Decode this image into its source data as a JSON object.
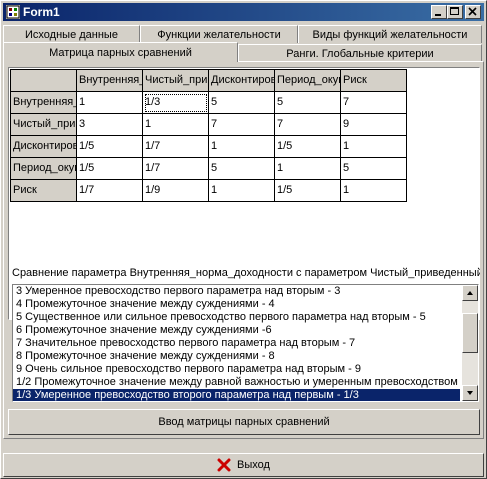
{
  "window": {
    "title": "Form1"
  },
  "tabs": {
    "row1": [
      "Исходные данные",
      "Функции желательности",
      "Виды функций желательности"
    ],
    "row2": [
      "Матрица парных сравнений",
      "Ранги. Глобальные критерии"
    ]
  },
  "grid": {
    "columns": [
      "Внутренняя_норма_доходности",
      "Чистый_приведенный",
      "Дисконтированный",
      "Период_окупаемости",
      "Риск"
    ],
    "rows": [
      {
        "name": "Внутренняя_норма_доходности",
        "values": [
          "1",
          "1/3",
          "5",
          "5",
          "7"
        ]
      },
      {
        "name": "Чистый_приведенный",
        "values": [
          "3",
          "1",
          "7",
          "7",
          "9"
        ]
      },
      {
        "name": "Дисконтированный",
        "values": [
          "1/5",
          "1/7",
          "1",
          "1/5",
          "1"
        ]
      },
      {
        "name": "Период_окупаемости",
        "values": [
          "1/5",
          "1/7",
          "5",
          "1",
          "5"
        ]
      },
      {
        "name": "Риск",
        "values": [
          "1/7",
          "1/9",
          "1",
          "1/5",
          "1"
        ]
      }
    ]
  },
  "comparison_label": "Сравнение параметра Внутренняя_норма_доходности с параметром Чистый_приведенный",
  "list": {
    "items": [
      "3 Умеренное превосходство первого параметра  над вторым - 3",
      "4 Промежуточное значение между суждениями - 4",
      "5 Существенное или сильное превосходство первого параметра над вторым - 5",
      "6 Промежуточное значение между суждениями -6",
      "7 Значительное превосходство  первого параметра  над вторым - 7",
      "8 Промежуточное значение между суждениями - 8",
      "9 Очень сильное превосходство  первого параметра  над вторым - 9",
      "1/2 Промежуточное значение между равной важностью и умеренным превосходством",
      "1/3 Умеренное превосходство второго параметра  над первым - 1/3"
    ],
    "selected_index": 8
  },
  "buttons": {
    "enter_matrix": "Ввод матрицы парных сравнений",
    "exit": "Выход"
  },
  "colors": {
    "titlebar": "#0a246a",
    "selection": "#0a246a",
    "exit_icon": "#cc0000"
  }
}
